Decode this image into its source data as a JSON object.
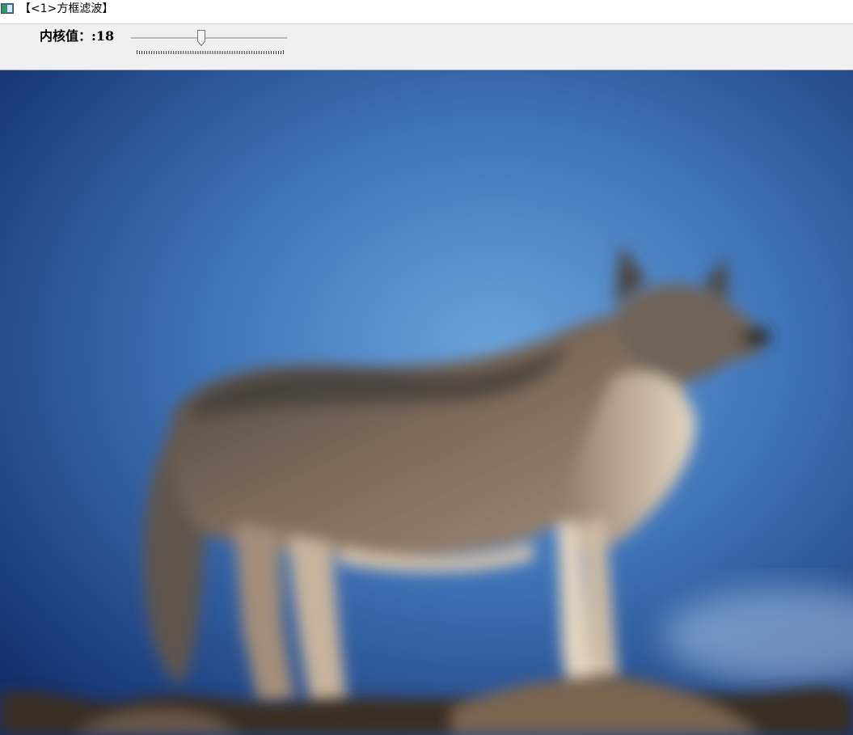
{
  "window": {
    "title": "【<1>方框滤波】",
    "icon": "opencv-window-icon"
  },
  "trackbar": {
    "label": "内核值：:18",
    "value": 18,
    "fraction": 0.45
  },
  "image": {
    "description_icon": "wolf-photo",
    "colors": {
      "sky_dark": "#14306e",
      "sky_mid": "#3f74b8",
      "sky_light": "#6aa3dc",
      "fur_dark": "#4a4542",
      "fur_mid": "#7e6a5a",
      "fur_light": "#c9b39b",
      "rock": "#3a2e24"
    }
  }
}
